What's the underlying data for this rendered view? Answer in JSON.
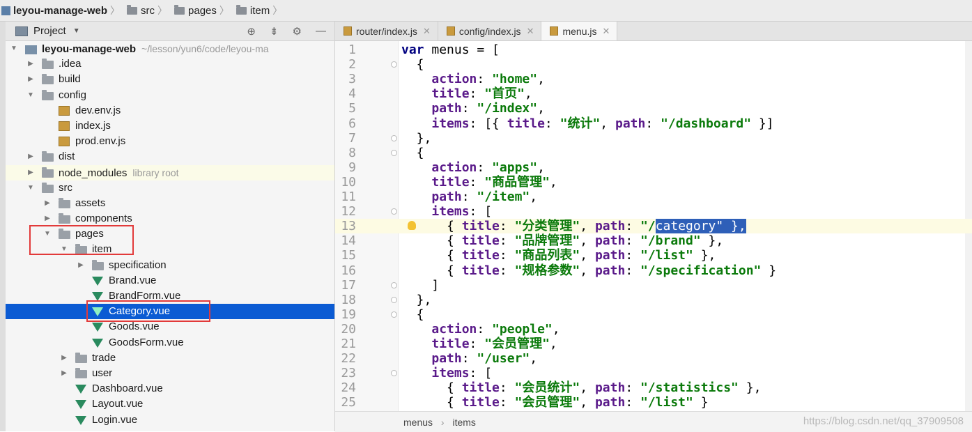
{
  "breadcrumb": [
    "leyou-manage-web",
    "src",
    "pages",
    "item"
  ],
  "project_panel": {
    "title": "Project",
    "tree": [
      {
        "label": "leyou-manage-web",
        "hint": "~/lesson/yun6/code/leyou-ma",
        "type": "project",
        "depth": 0,
        "arrow": "down"
      },
      {
        "label": ".idea",
        "type": "folder",
        "depth": 1,
        "arrow": "right"
      },
      {
        "label": "build",
        "type": "folder",
        "depth": 1,
        "arrow": "right"
      },
      {
        "label": "config",
        "type": "folder",
        "depth": 1,
        "arrow": "down"
      },
      {
        "label": "dev.env.js",
        "type": "js",
        "depth": 2
      },
      {
        "label": "index.js",
        "type": "js",
        "depth": 2
      },
      {
        "label": "prod.env.js",
        "type": "js",
        "depth": 2
      },
      {
        "label": "dist",
        "type": "folder",
        "depth": 1,
        "arrow": "right"
      },
      {
        "label": "node_modules",
        "hint": "library root",
        "type": "folder",
        "depth": 1,
        "arrow": "right",
        "lib": true
      },
      {
        "label": "src",
        "type": "folder",
        "depth": 1,
        "arrow": "down"
      },
      {
        "label": "assets",
        "type": "folder",
        "depth": 2,
        "arrow": "right"
      },
      {
        "label": "components",
        "type": "folder",
        "depth": 2,
        "arrow": "right"
      },
      {
        "label": "pages",
        "type": "folder",
        "depth": 2,
        "arrow": "down"
      },
      {
        "label": "item",
        "type": "folder",
        "depth": 3,
        "arrow": "down"
      },
      {
        "label": "specification",
        "type": "folder",
        "depth": 4,
        "arrow": "right"
      },
      {
        "label": "Brand.vue",
        "type": "vue",
        "depth": 4
      },
      {
        "label": "BrandForm.vue",
        "type": "vue",
        "depth": 4
      },
      {
        "label": "Category.vue",
        "type": "vue",
        "depth": 4,
        "selected": true
      },
      {
        "label": "Goods.vue",
        "type": "vue",
        "depth": 4
      },
      {
        "label": "GoodsForm.vue",
        "type": "vue",
        "depth": 4
      },
      {
        "label": "trade",
        "type": "folder",
        "depth": 3,
        "arrow": "right"
      },
      {
        "label": "user",
        "type": "folder",
        "depth": 3,
        "arrow": "right"
      },
      {
        "label": "Dashboard.vue",
        "type": "vue",
        "depth": 3
      },
      {
        "label": "Layout.vue",
        "type": "vue",
        "depth": 3
      },
      {
        "label": "Login.vue",
        "type": "vue",
        "depth": 3
      }
    ]
  },
  "tabs": [
    {
      "label": "router/index.js",
      "active": false
    },
    {
      "label": "config/index.js",
      "active": false
    },
    {
      "label": "menu.js",
      "active": true
    }
  ],
  "editor": {
    "highlight_line": 13,
    "lines": [
      [
        [
          "kw",
          "var"
        ],
        [
          "p",
          " menus = ["
        ]
      ],
      [
        [
          "p",
          "  {"
        ]
      ],
      [
        [
          "p",
          "    "
        ],
        [
          "key",
          "action"
        ],
        [
          "p",
          ": "
        ],
        [
          "str",
          "\"home\""
        ],
        [
          "p",
          ","
        ]
      ],
      [
        [
          "p",
          "    "
        ],
        [
          "key",
          "title"
        ],
        [
          "p",
          ": "
        ],
        [
          "str",
          "\"首页\""
        ],
        [
          "p",
          ","
        ]
      ],
      [
        [
          "p",
          "    "
        ],
        [
          "key",
          "path"
        ],
        [
          "p",
          ": "
        ],
        [
          "str",
          "\"/index\""
        ],
        [
          "p",
          ","
        ]
      ],
      [
        [
          "p",
          "    "
        ],
        [
          "key",
          "items"
        ],
        [
          "p",
          ": [{ "
        ],
        [
          "key",
          "title"
        ],
        [
          "p",
          ": "
        ],
        [
          "str",
          "\"统计\""
        ],
        [
          "p",
          ", "
        ],
        [
          "key",
          "path"
        ],
        [
          "p",
          ": "
        ],
        [
          "str",
          "\"/dashboard\""
        ],
        [
          "p",
          " }]"
        ]
      ],
      [
        [
          "p",
          "  },"
        ]
      ],
      [
        [
          "p",
          "  {"
        ]
      ],
      [
        [
          "p",
          "    "
        ],
        [
          "key",
          "action"
        ],
        [
          "p",
          ": "
        ],
        [
          "str",
          "\"apps\""
        ],
        [
          "p",
          ","
        ]
      ],
      [
        [
          "p",
          "    "
        ],
        [
          "key",
          "title"
        ],
        [
          "p",
          ": "
        ],
        [
          "str",
          "\"商品管理\""
        ],
        [
          "p",
          ","
        ]
      ],
      [
        [
          "p",
          "    "
        ],
        [
          "key",
          "path"
        ],
        [
          "p",
          ": "
        ],
        [
          "str",
          "\"/item\""
        ],
        [
          "p",
          ","
        ]
      ],
      [
        [
          "p",
          "    "
        ],
        [
          "key",
          "items"
        ],
        [
          "p",
          ": ["
        ]
      ],
      [
        [
          "p",
          "      { "
        ],
        [
          "key",
          "title"
        ],
        [
          "p",
          ": "
        ],
        [
          "str",
          "\"分类管理\""
        ],
        [
          "p",
          ", "
        ],
        [
          "key",
          "path"
        ],
        [
          "p",
          ": "
        ],
        [
          "str",
          "\"/"
        ],
        [
          "sel",
          "category\" },"
        ]
      ],
      [
        [
          "p",
          "      { "
        ],
        [
          "key",
          "title"
        ],
        [
          "p",
          ": "
        ],
        [
          "str",
          "\"品牌管理\""
        ],
        [
          "p",
          ", "
        ],
        [
          "key",
          "path"
        ],
        [
          "p",
          ": "
        ],
        [
          "str",
          "\"/brand\""
        ],
        [
          "p",
          " },"
        ]
      ],
      [
        [
          "p",
          "      { "
        ],
        [
          "key",
          "title"
        ],
        [
          "p",
          ": "
        ],
        [
          "str",
          "\"商品列表\""
        ],
        [
          "p",
          ", "
        ],
        [
          "key",
          "path"
        ],
        [
          "p",
          ": "
        ],
        [
          "str",
          "\"/list\""
        ],
        [
          "p",
          " },"
        ]
      ],
      [
        [
          "p",
          "      { "
        ],
        [
          "key",
          "title"
        ],
        [
          "p",
          ": "
        ],
        [
          "str",
          "\"规格参数\""
        ],
        [
          "p",
          ", "
        ],
        [
          "key",
          "path"
        ],
        [
          "p",
          ": "
        ],
        [
          "str",
          "\"/specification\""
        ],
        [
          "p",
          " }"
        ]
      ],
      [
        [
          "p",
          "    ]"
        ]
      ],
      [
        [
          "p",
          "  },"
        ]
      ],
      [
        [
          "p",
          "  {"
        ]
      ],
      [
        [
          "p",
          "    "
        ],
        [
          "key",
          "action"
        ],
        [
          "p",
          ": "
        ],
        [
          "str",
          "\"people\""
        ],
        [
          "p",
          ","
        ]
      ],
      [
        [
          "p",
          "    "
        ],
        [
          "key",
          "title"
        ],
        [
          "p",
          ": "
        ],
        [
          "str",
          "\"会员管理\""
        ],
        [
          "p",
          ","
        ]
      ],
      [
        [
          "p",
          "    "
        ],
        [
          "key",
          "path"
        ],
        [
          "p",
          ": "
        ],
        [
          "str",
          "\"/user\""
        ],
        [
          "p",
          ","
        ]
      ],
      [
        [
          "p",
          "    "
        ],
        [
          "key",
          "items"
        ],
        [
          "p",
          ": ["
        ]
      ],
      [
        [
          "p",
          "      { "
        ],
        [
          "key",
          "title"
        ],
        [
          "p",
          ": "
        ],
        [
          "str",
          "\"会员统计\""
        ],
        [
          "p",
          ", "
        ],
        [
          "key",
          "path"
        ],
        [
          "p",
          ": "
        ],
        [
          "str",
          "\"/statistics\""
        ],
        [
          "p",
          " },"
        ]
      ],
      [
        [
          "p",
          "      { "
        ],
        [
          "key",
          "title"
        ],
        [
          "p",
          ": "
        ],
        [
          "str",
          "\"会员管理\""
        ],
        [
          "p",
          ", "
        ],
        [
          "key",
          "path"
        ],
        [
          "p",
          ": "
        ],
        [
          "str",
          "\"/list\""
        ],
        [
          "p",
          " }"
        ]
      ]
    ]
  },
  "status_breadcrumb": [
    "menus",
    "items"
  ],
  "watermark": "https://blog.csdn.net/qq_37909508"
}
